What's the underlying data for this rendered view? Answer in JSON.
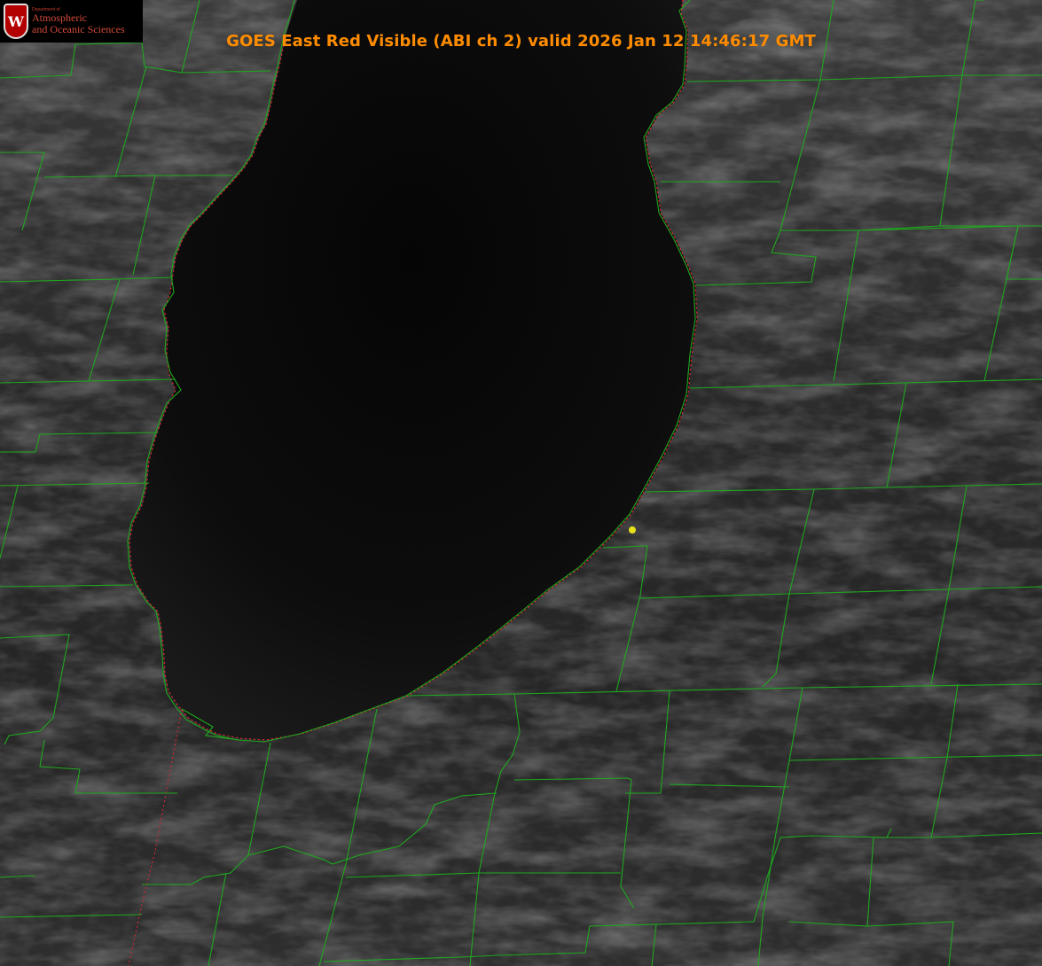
{
  "title": "GOES East Red Visible (ABI ch 2) valid 2026 Jan 12 14:46:17 GMT",
  "logo": {
    "department": "Department of",
    "line1": "Atmospheric",
    "line2": "and Oceanic Sciences",
    "crest_letter": "W"
  },
  "colors": {
    "title": "#ff8c00",
    "boundaries": "#1fa81f",
    "coastline": "#e8232e",
    "marker": "#e8e21a"
  }
}
